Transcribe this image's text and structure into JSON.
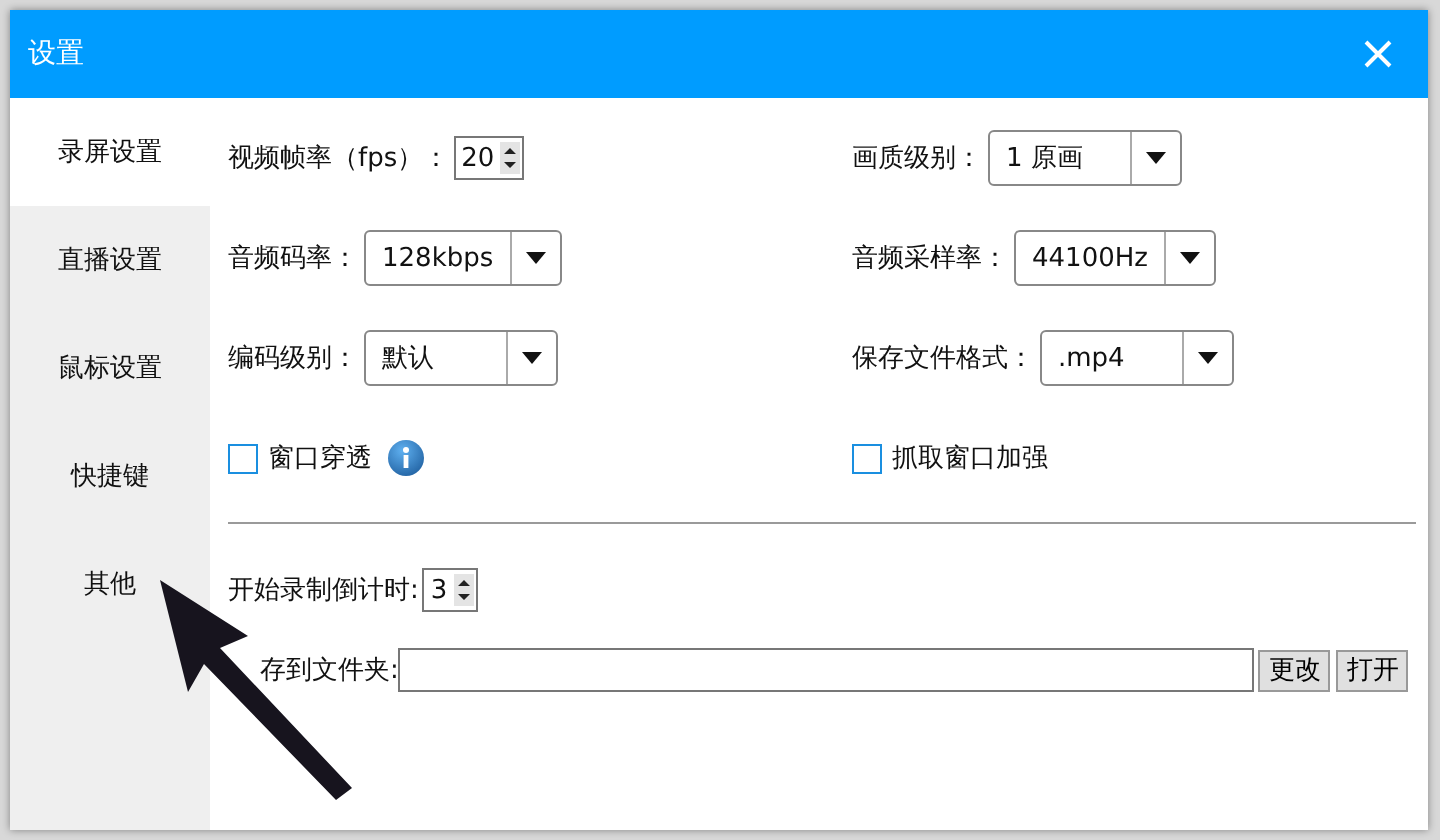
{
  "window": {
    "title": "设置"
  },
  "sidebar": {
    "items": [
      {
        "label": "录屏设置",
        "selected": true
      },
      {
        "label": "直播设置",
        "selected": false
      },
      {
        "label": "鼠标设置",
        "selected": false
      },
      {
        "label": "快捷键",
        "selected": false
      },
      {
        "label": "其他",
        "selected": false
      }
    ]
  },
  "settings": [
    {
      "kind": "spinner",
      "label": "视频帧率（fps）：",
      "value": "20"
    },
    {
      "kind": "dropdown",
      "label": "画质级别：",
      "value": "1 原画"
    },
    {
      "kind": "dropdown",
      "label": "音频码率：",
      "value": "128kbps"
    },
    {
      "kind": "dropdown",
      "label": "音频采样率：",
      "value": "44100Hz"
    },
    {
      "kind": "dropdown",
      "label": "编码级别：",
      "value": "默认"
    },
    {
      "kind": "dropdown",
      "label": "保存文件格式：",
      "value": ".mp4"
    },
    {
      "kind": "checkbox",
      "label": "窗口穿透",
      "checked": false,
      "info": true
    },
    {
      "kind": "checkbox",
      "label": "抓取窗口加强",
      "checked": false,
      "info": false
    }
  ],
  "countdown": {
    "label": "开始录制倒计时:",
    "value": "3"
  },
  "folder": {
    "label": "存到文件夹:",
    "buttons": [
      "更改",
      "打开"
    ]
  }
}
